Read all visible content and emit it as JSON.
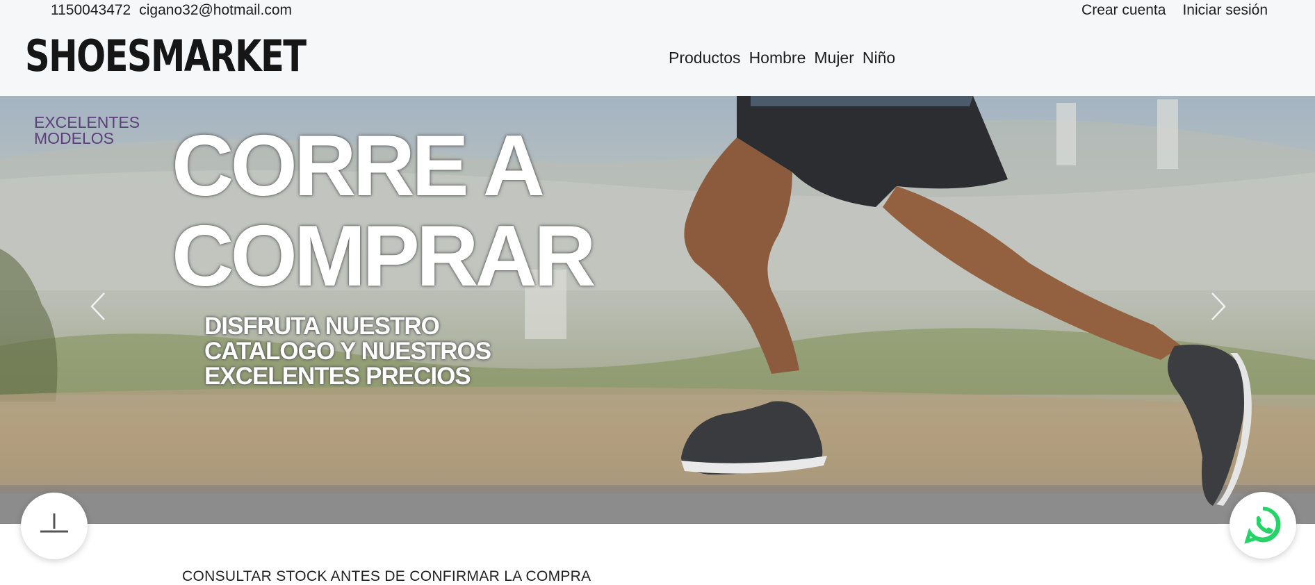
{
  "topbar": {
    "phone": "1150043472",
    "email": "cigano32@hotmail.com",
    "create_account": "Crear cuenta",
    "login": "Iniciar sesión"
  },
  "logo": "SHOESMARKET",
  "nav": [
    "Productos",
    "Hombre",
    "Mujer",
    "Niño"
  ],
  "hero": {
    "badge_line1": "EXCELENTES",
    "badge_line2": "MODELOS",
    "headline_line1": "CORRE A",
    "headline_line2": "COMPRAR",
    "sub_line1": "DISFRUTA NUESTRO",
    "sub_line2": "CATALOGO Y NUESTROS",
    "sub_line3": "EXCELENTES PRECIOS",
    "prev_icon": "chevron-left-icon",
    "next_icon": "chevron-right-icon"
  },
  "floating": {
    "upload_icon": "upload-icon",
    "whatsapp_icon": "whatsapp-icon",
    "whatsapp_color": "#25d366"
  },
  "notice": "CONSULTAR STOCK ANTES DE CONFIRMAR LA COMPRA"
}
